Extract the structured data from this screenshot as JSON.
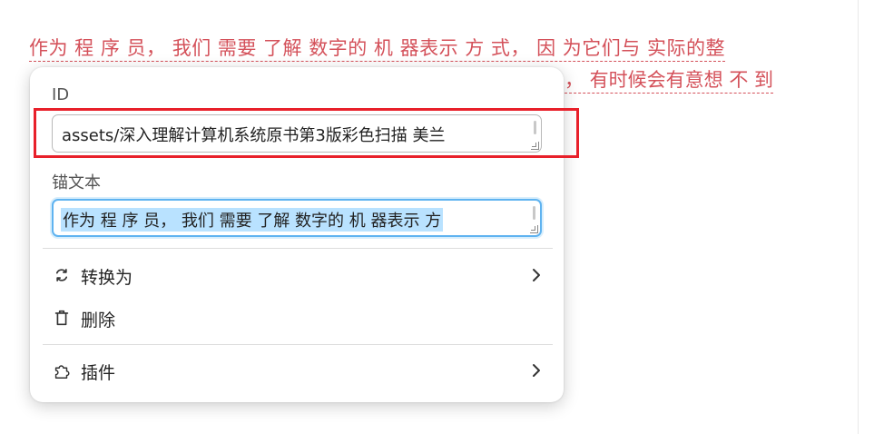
{
  "document": {
    "line1": "作为 程 序 员， 我们 需要 了解 数字的 机 器表示 方 式， 因 为它们与 实际的整",
    "line2_visible": "， 有时候会有意想 不 到"
  },
  "popup": {
    "id_label": "ID",
    "id_value": "assets/深入理解计算机系统原书第3版彩色扫描 美兰",
    "anchor_label": "锚文本",
    "anchor_value": "作为 程 序 员， 我们 需要 了解 数字的 机 器表示 方",
    "menu": {
      "convert_label": "转换为",
      "delete_label": "删除",
      "plugins_label": "插件"
    }
  },
  "icons": {
    "convert": "refresh-icon",
    "delete": "trash-icon",
    "plugins": "puzzle-icon",
    "submenu": "chevron-right-icon"
  },
  "colors": {
    "link_text": "#d4515a",
    "highlight_border": "#e8202a",
    "focus_border": "#5fb3f0",
    "selection": "#b9e2ff"
  }
}
